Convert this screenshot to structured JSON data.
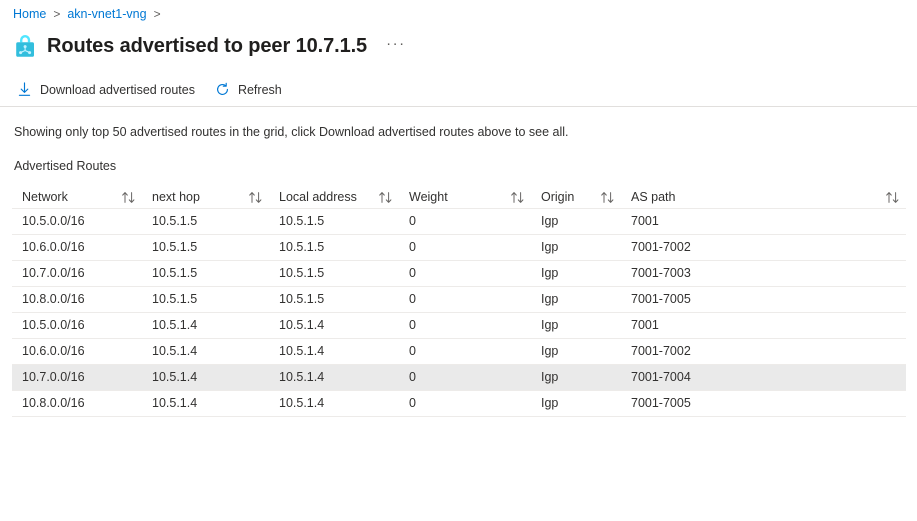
{
  "breadcrumb": {
    "items": [
      {
        "label": "Home",
        "sep": ">"
      },
      {
        "label": "akn-vnet1-vng",
        "sep": ">"
      }
    ]
  },
  "header": {
    "icon": "vpn-gateway-lock-icon",
    "title": "Routes advertised to peer 10.7.1.5",
    "more_label": "···"
  },
  "commandbar": {
    "download": {
      "icon": "download-icon",
      "label": "Download advertised routes"
    },
    "refresh": {
      "icon": "refresh-icon",
      "label": "Refresh"
    }
  },
  "notice": {
    "text": "Showing only top 50 advertised routes in the grid, click Download advertised routes above to see all."
  },
  "grid": {
    "caption": "Advertised Routes",
    "sort_icon": "sort-updown-icon",
    "columns": [
      {
        "key": "network",
        "label": "Network",
        "sortable": true
      },
      {
        "key": "next_hop",
        "label": "next hop",
        "sortable": true
      },
      {
        "key": "local_address",
        "label": "Local address",
        "sortable": true
      },
      {
        "key": "weight",
        "label": "Weight",
        "sortable": true
      },
      {
        "key": "origin",
        "label": "Origin",
        "sortable": true
      },
      {
        "key": "as_path",
        "label": "AS path",
        "sortable": true
      }
    ],
    "rows": [
      {
        "network": "10.5.0.0/16",
        "next_hop": "10.5.1.5",
        "local_address": "10.5.1.5",
        "weight": "0",
        "origin": "Igp",
        "as_path": "7001",
        "highlighted": false
      },
      {
        "network": "10.6.0.0/16",
        "next_hop": "10.5.1.5",
        "local_address": "10.5.1.5",
        "weight": "0",
        "origin": "Igp",
        "as_path": "7001-7002",
        "highlighted": false
      },
      {
        "network": "10.7.0.0/16",
        "next_hop": "10.5.1.5",
        "local_address": "10.5.1.5",
        "weight": "0",
        "origin": "Igp",
        "as_path": "7001-7003",
        "highlighted": false
      },
      {
        "network": "10.8.0.0/16",
        "next_hop": "10.5.1.5",
        "local_address": "10.5.1.5",
        "weight": "0",
        "origin": "Igp",
        "as_path": "7001-7005",
        "highlighted": false
      },
      {
        "network": "10.5.0.0/16",
        "next_hop": "10.5.1.4",
        "local_address": "10.5.1.4",
        "weight": "0",
        "origin": "Igp",
        "as_path": "7001",
        "highlighted": false
      },
      {
        "network": "10.6.0.0/16",
        "next_hop": "10.5.1.4",
        "local_address": "10.5.1.4",
        "weight": "0",
        "origin": "Igp",
        "as_path": "7001-7002",
        "highlighted": false
      },
      {
        "network": "10.7.0.0/16",
        "next_hop": "10.5.1.4",
        "local_address": "10.5.1.4",
        "weight": "0",
        "origin": "Igp",
        "as_path": "7001-7004",
        "highlighted": true
      },
      {
        "network": "10.8.0.0/16",
        "next_hop": "10.5.1.4",
        "local_address": "10.5.1.4",
        "weight": "0",
        "origin": "Igp",
        "as_path": "7001-7005",
        "highlighted": false
      }
    ]
  },
  "colors": {
    "link": "#0078d4",
    "accent": "#0078d4",
    "text": "#323130",
    "row_divider": "#edebe9",
    "row_highlight": "#eaeaea",
    "icon_cyan": "#32bedd"
  }
}
